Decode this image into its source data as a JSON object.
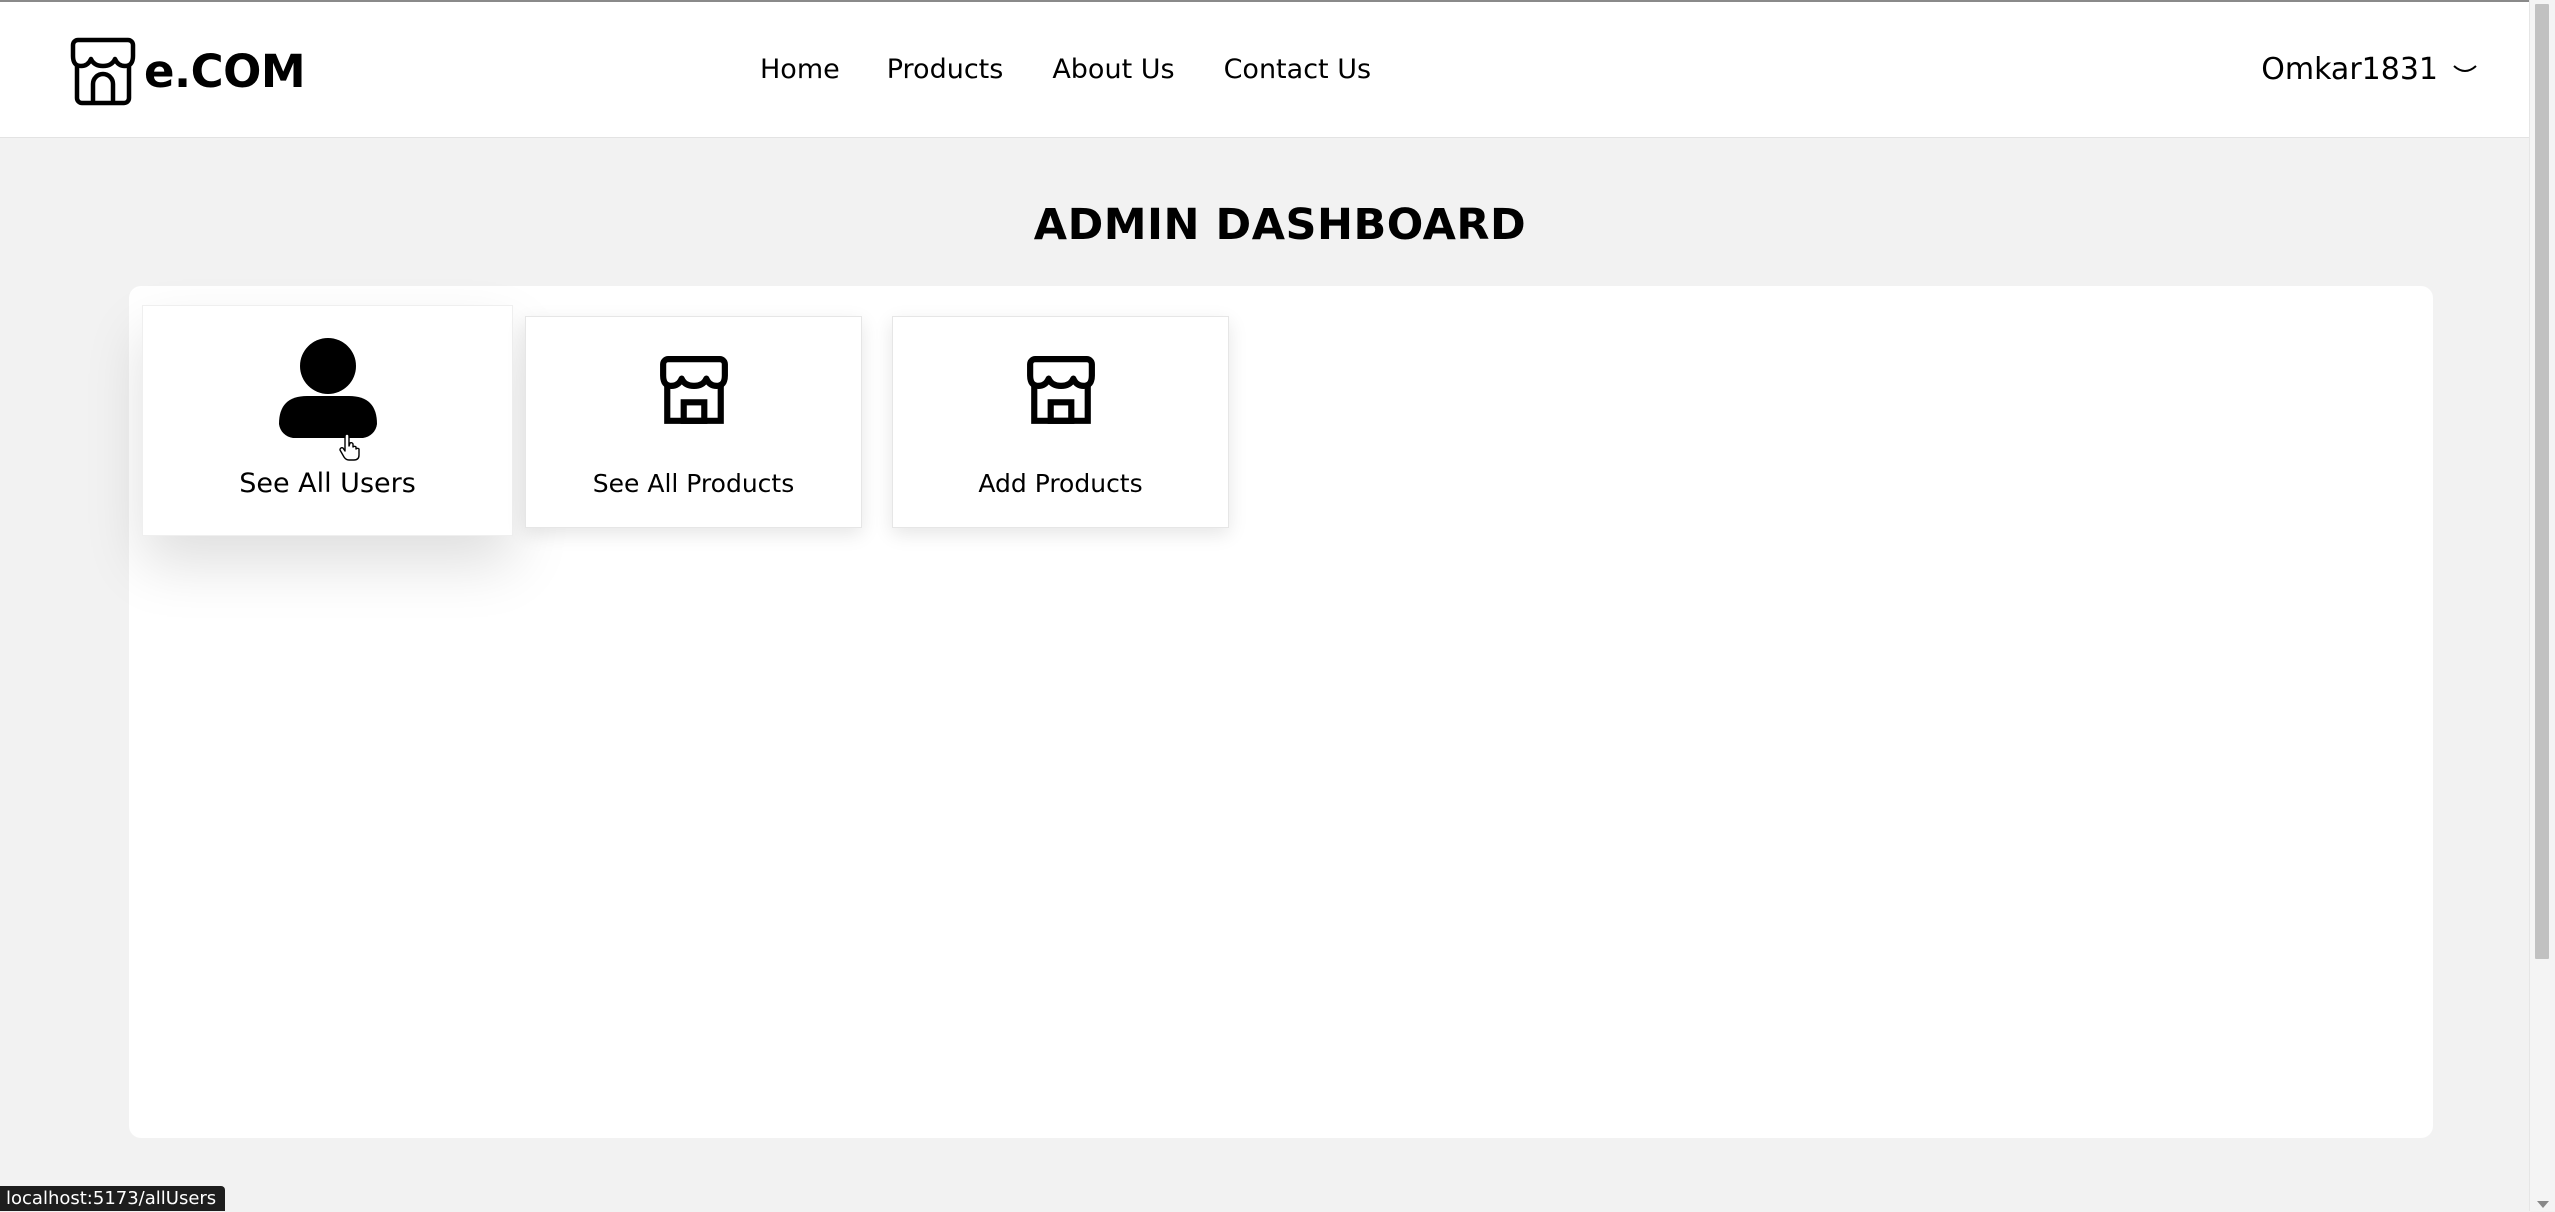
{
  "brand": {
    "name": "e.COM",
    "icon": "store-icon"
  },
  "nav": {
    "items": [
      {
        "label": "Home"
      },
      {
        "label": "Products"
      },
      {
        "label": "About Us"
      },
      {
        "label": "Contact Us"
      }
    ]
  },
  "user": {
    "username": "Omkar1831",
    "dropdown_icon": "chevron-down-icon"
  },
  "dashboard": {
    "title": "ADMIN DASHBOARD",
    "cards": [
      {
        "label": "See All Users",
        "icon": "user-icon"
      },
      {
        "label": "See All Products",
        "icon": "store-icon"
      },
      {
        "label": "Add Products",
        "icon": "store-icon"
      }
    ]
  },
  "status_bar": {
    "url": "localhost:5173/allUsers"
  }
}
